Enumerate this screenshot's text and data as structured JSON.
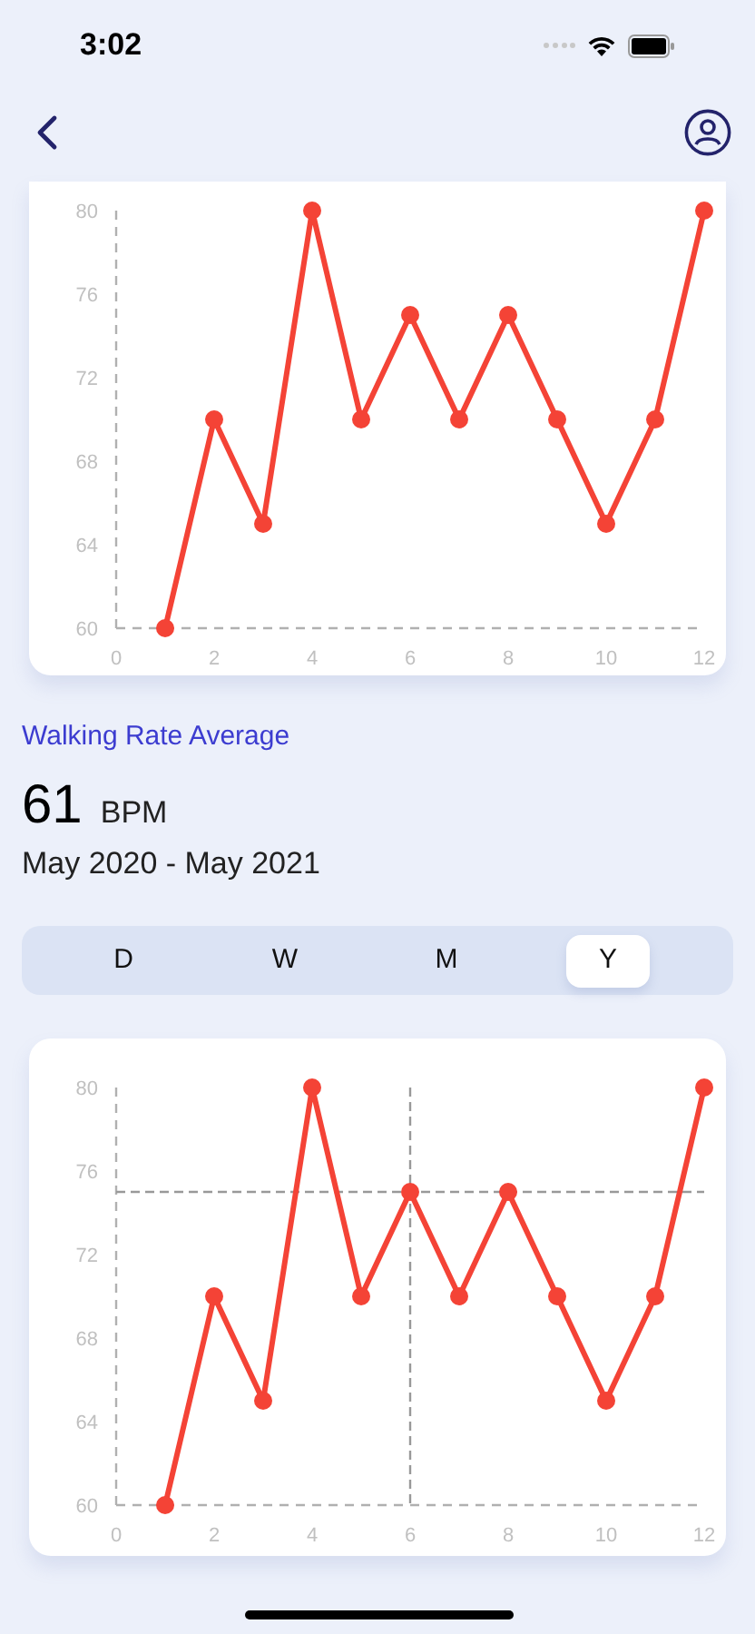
{
  "status_bar": {
    "time": "3:02"
  },
  "charts": [
    {
      "chart_data": {
        "type": "line",
        "x": [
          1,
          2,
          3,
          4,
          5,
          6,
          7,
          8,
          9,
          10,
          11,
          12
        ],
        "series": [
          {
            "color": "#f44336",
            "marker": true,
            "values": [
              60,
              70,
              65,
              80,
              70,
              75,
              70,
              75,
              70,
              65,
              70,
              80
            ]
          }
        ],
        "xlim": [
          0,
          12
        ],
        "ylim": [
          60,
          80
        ],
        "xticks": [
          0,
          2,
          4,
          6,
          8,
          10,
          12
        ],
        "yticks": [
          60,
          64,
          68,
          72,
          76,
          80
        ]
      }
    },
    {
      "chart_data": {
        "type": "line",
        "x": [
          1,
          2,
          3,
          4,
          5,
          6,
          7,
          8,
          9,
          10,
          11,
          12
        ],
        "series": [
          {
            "color": "#f44336",
            "marker": true,
            "values": [
              60,
              70,
              65,
              80,
              70,
              75,
              70,
              75,
              70,
              65,
              70,
              80
            ]
          }
        ],
        "xlim": [
          0,
          12
        ],
        "ylim": [
          60,
          80
        ],
        "xticks": [
          0,
          2,
          4,
          6,
          8,
          10,
          12
        ],
        "yticks": [
          60,
          64,
          68,
          72,
          76,
          80
        ],
        "ref_lines": [
          {
            "axis": "x",
            "value": 6
          },
          {
            "axis": "y",
            "value": 75
          }
        ]
      }
    }
  ],
  "summary": {
    "title": "Walking Rate Average",
    "value": "61",
    "unit": "BPM",
    "period": "May 2020 - May 2021"
  },
  "range_tabs": [
    {
      "label": "D",
      "selected": false
    },
    {
      "label": "W",
      "selected": false
    },
    {
      "label": "M",
      "selected": false
    },
    {
      "label": "Y",
      "selected": true
    }
  ]
}
